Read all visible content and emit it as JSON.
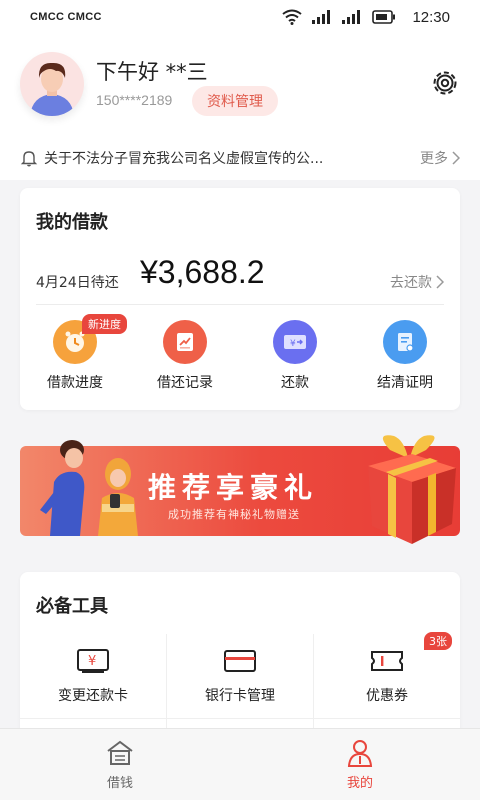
{
  "status_bar": {
    "carrier": "CMCC CMCC",
    "time": "12:30"
  },
  "header": {
    "greeting": "下午好  **三",
    "phone": "150****2189",
    "profile_button": "资料管理"
  },
  "notice": {
    "text": "关于不法分子冒充我公司名义虚假宣传的公...",
    "more": "更多"
  },
  "loan_card": {
    "title": "我的借款",
    "due_label": "4月24日待还",
    "amount": "¥3,688.2",
    "repay_link": "去还款",
    "actions": [
      {
        "label": "借款进度",
        "icon": "clock-icon",
        "badge": "新进度"
      },
      {
        "label": "借还记录",
        "icon": "record-icon"
      },
      {
        "label": "还款",
        "icon": "yuan-ticket-icon"
      },
      {
        "label": "结清证明",
        "icon": "certificate-icon"
      }
    ]
  },
  "banner": {
    "title": "推荐享豪礼",
    "subtitle": "成功推荐有神秘礼物赠送"
  },
  "tools_card": {
    "title": "必备工具",
    "items": [
      {
        "label": "变更还款卡",
        "icon": "yuan-card-icon"
      },
      {
        "label": "银行卡管理",
        "icon": "bank-card-icon"
      },
      {
        "label": "优惠券",
        "icon": "coupon-icon",
        "badge": "3张"
      }
    ]
  },
  "tabbar": {
    "tabs": [
      {
        "label": "借钱",
        "icon": "home-icon",
        "active": false
      },
      {
        "label": "我的",
        "icon": "user-icon",
        "active": true
      }
    ]
  },
  "colors": {
    "accent": "#e8463d",
    "inactive": "#666666"
  }
}
